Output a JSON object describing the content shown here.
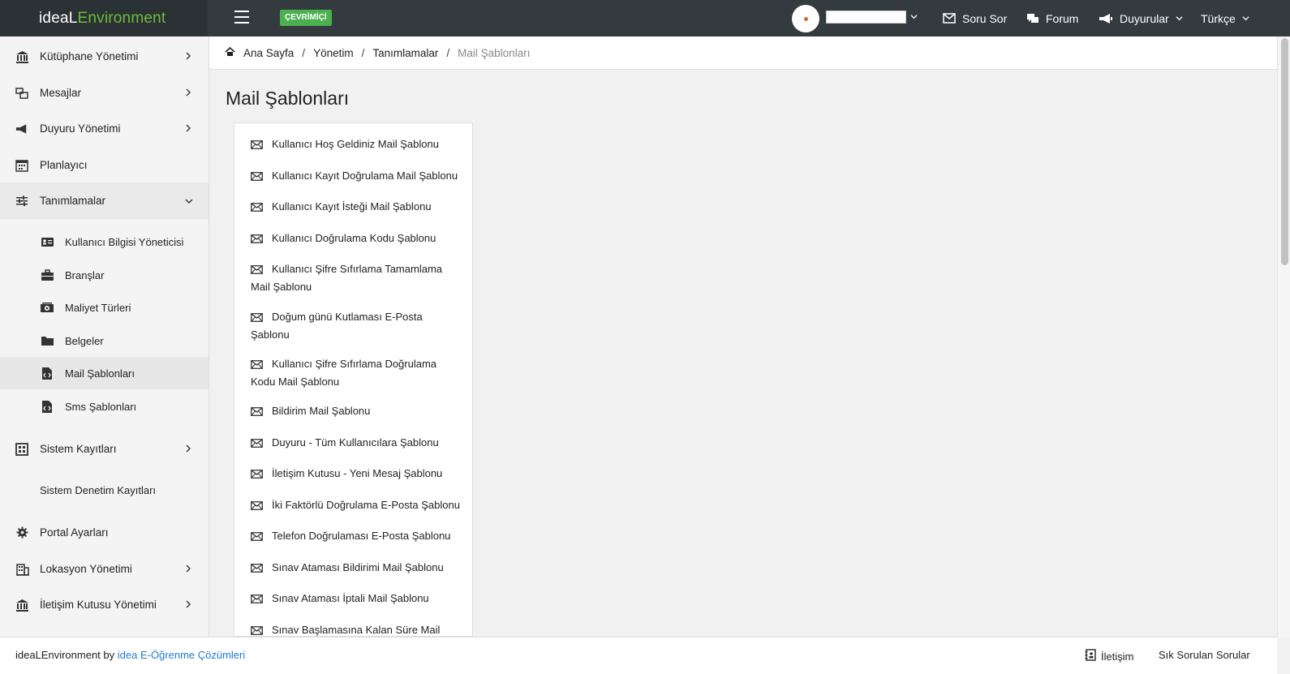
{
  "header": {
    "brand_part1": "ideaL",
    "brand_part2": "Environment",
    "status_badge": "ÇEVRİMİÇİ",
    "nav": {
      "ask": "Soru Sor",
      "forum": "Forum",
      "announcements": "Duyurular",
      "language": "Türkçe"
    }
  },
  "sidebar": {
    "items": [
      {
        "label": "Kütüphane Yönetimi",
        "icon": "library-icon"
      },
      {
        "label": "Mesajlar",
        "icon": "messages-icon"
      },
      {
        "label": "Duyuru Yönetimi",
        "icon": "megaphone-icon"
      },
      {
        "label": "Planlayıcı",
        "icon": "calendar-icon"
      },
      {
        "label": "Tanımlamalar",
        "icon": "sliders-icon"
      }
    ],
    "subitems": [
      {
        "label": "Kullanıcı Bilgisi Yöneticisi",
        "icon": "id-card-icon"
      },
      {
        "label": "Branşlar",
        "icon": "briefcase-icon"
      },
      {
        "label": "Maliyet Türleri",
        "icon": "money-icon"
      },
      {
        "label": "Belgeler",
        "icon": "folder-icon"
      },
      {
        "label": "Mail Şablonları",
        "icon": "file-code-icon"
      },
      {
        "label": "Sms Şablonları",
        "icon": "file-code-icon"
      }
    ],
    "lower": [
      {
        "label": "Sistem Kayıtları",
        "icon": "grid-icon"
      },
      {
        "label": "Sistem Denetim Kayıtları"
      },
      {
        "label": "Portal Ayarları",
        "icon": "gear-icon"
      },
      {
        "label": "Lokasyon Yönetimi",
        "icon": "building-icon"
      },
      {
        "label": "İletişim Kutusu Yönetimi",
        "icon": "library-icon"
      }
    ]
  },
  "breadcrumb": {
    "home": "Ana Sayfa",
    "admin": "Yönetim",
    "definitions": "Tanımlamalar",
    "current": "Mail Şablonları",
    "separator": "/"
  },
  "main": {
    "title": "Mail Şablonları",
    "templates": [
      "Kullanıcı Hoş Geldiniz Mail Şablonu",
      "Kullanıcı Kayıt Doğrulama Mail Şablonu",
      "Kullanıcı Kayıt İsteği Mail Şablonu",
      "Kullanıcı Doğrulama Kodu Şablonu",
      "Kullanıcı Şifre Sıfırlama Tamamlama Mail Şablonu",
      "Doğum günü Kutlaması E-Posta Şablonu",
      "Kullanıcı Şifre Sıfırlama Doğrulama Kodu Mail Şablonu",
      "Bildirim Mail Şablonu",
      "Duyuru - Tüm Kullanıcılara Şablonu",
      "İletişim Kutusu - Yeni Mesaj Şablonu",
      "İki Faktörlü Doğrulama E-Posta Şablonu",
      "Telefon Doğrulaması E-Posta Şablonu",
      "Sınav Ataması Bildirimi Mail Şablonu",
      "Sınav Ataması İptali Mail Şablonu",
      "Sınav Başlamasına Kalan Süre Mail"
    ]
  },
  "footer": {
    "product": "ideaLEnvironment by ",
    "company": "idea E-Öğrenme Çözümleri",
    "contact": "İletişim",
    "faq": "Sık Sorulan Sorular"
  },
  "colors": {
    "topbar": "#333b3f",
    "brand_accent": "#6abf3a",
    "badge": "#4caf50",
    "link": "#1f7ed0"
  }
}
